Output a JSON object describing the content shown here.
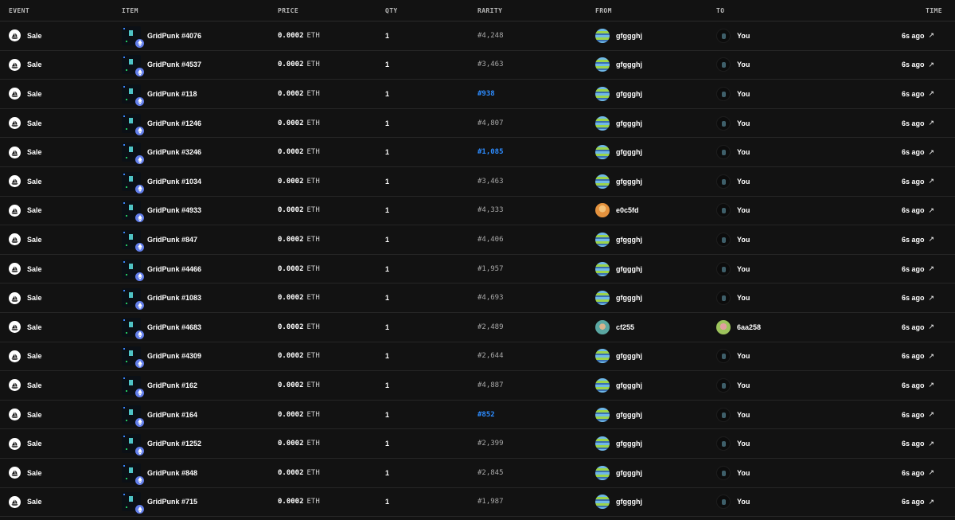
{
  "headers": {
    "event": "EVENT",
    "item": "ITEM",
    "price": "PRICE",
    "qty": "QTY",
    "rarity": "RARITY",
    "from": "FROM",
    "to": "TO",
    "time": "TIME"
  },
  "icons": {
    "event": "opensea-logo-icon",
    "chain": "ethereum-icon",
    "time": "external-link-arrow-icon"
  },
  "colors": {
    "background": "#121212",
    "highlight_rarity": "#2d8cff",
    "eth_badge": "#627eea"
  },
  "rows": [
    {
      "event": "Sale",
      "item": "GridPunk #4076",
      "price": "0.0002",
      "unit": "ETH",
      "qty": "1",
      "rarity": "#4,248",
      "rarity_highlight": false,
      "from": "gfggghj",
      "from_avatar": "stripe",
      "to": "You",
      "to_avatar": "dark",
      "time": "6s ago",
      "arrow": "↗"
    },
    {
      "event": "Sale",
      "item": "GridPunk #4537",
      "price": "0.0002",
      "unit": "ETH",
      "qty": "1",
      "rarity": "#3,463",
      "rarity_highlight": false,
      "from": "gfggghj",
      "from_avatar": "stripe",
      "to": "You",
      "to_avatar": "dark",
      "time": "6s ago",
      "arrow": "↗"
    },
    {
      "event": "Sale",
      "item": "GridPunk #118",
      "price": "0.0002",
      "unit": "ETH",
      "qty": "1",
      "rarity": "#938",
      "rarity_highlight": true,
      "from": "gfggghj",
      "from_avatar": "stripe",
      "to": "You",
      "to_avatar": "dark",
      "time": "6s ago",
      "arrow": "↗"
    },
    {
      "event": "Sale",
      "item": "GridPunk #1246",
      "price": "0.0002",
      "unit": "ETH",
      "qty": "1",
      "rarity": "#4,807",
      "rarity_highlight": false,
      "from": "gfggghj",
      "from_avatar": "stripe",
      "to": "You",
      "to_avatar": "dark",
      "time": "6s ago",
      "arrow": "↗"
    },
    {
      "event": "Sale",
      "item": "GridPunk #3246",
      "price": "0.0002",
      "unit": "ETH",
      "qty": "1",
      "rarity": "#1,085",
      "rarity_highlight": true,
      "from": "gfggghj",
      "from_avatar": "stripe",
      "to": "You",
      "to_avatar": "dark",
      "time": "6s ago",
      "arrow": "↗"
    },
    {
      "event": "Sale",
      "item": "GridPunk #1034",
      "price": "0.0002",
      "unit": "ETH",
      "qty": "1",
      "rarity": "#3,463",
      "rarity_highlight": false,
      "from": "gfggghj",
      "from_avatar": "stripe",
      "to": "You",
      "to_avatar": "dark",
      "time": "6s ago",
      "arrow": "↗"
    },
    {
      "event": "Sale",
      "item": "GridPunk #4933",
      "price": "0.0002",
      "unit": "ETH",
      "qty": "1",
      "rarity": "#4,333",
      "rarity_highlight": false,
      "from": "e0c5fd",
      "from_avatar": "orange",
      "to": "You",
      "to_avatar": "dark",
      "time": "6s ago",
      "arrow": "↗"
    },
    {
      "event": "Sale",
      "item": "GridPunk #847",
      "price": "0.0002",
      "unit": "ETH",
      "qty": "1",
      "rarity": "#4,406",
      "rarity_highlight": false,
      "from": "gfggghj",
      "from_avatar": "stripe",
      "to": "You",
      "to_avatar": "dark",
      "time": "6s ago",
      "arrow": "↗"
    },
    {
      "event": "Sale",
      "item": "GridPunk #4466",
      "price": "0.0002",
      "unit": "ETH",
      "qty": "1",
      "rarity": "#1,957",
      "rarity_highlight": false,
      "from": "gfggghj",
      "from_avatar": "stripe",
      "to": "You",
      "to_avatar": "dark",
      "time": "6s ago",
      "arrow": "↗"
    },
    {
      "event": "Sale",
      "item": "GridPunk #1083",
      "price": "0.0002",
      "unit": "ETH",
      "qty": "1",
      "rarity": "#4,693",
      "rarity_highlight": false,
      "from": "gfggghj",
      "from_avatar": "stripe",
      "to": "You",
      "to_avatar": "dark",
      "time": "6s ago",
      "arrow": "↗"
    },
    {
      "event": "Sale",
      "item": "GridPunk #4683",
      "price": "0.0002",
      "unit": "ETH",
      "qty": "1",
      "rarity": "#2,489",
      "rarity_highlight": false,
      "from": "cf255",
      "from_avatar": "teal",
      "to": "6aa258",
      "to_avatar": "green",
      "time": "6s ago",
      "arrow": "↗"
    },
    {
      "event": "Sale",
      "item": "GridPunk #4309",
      "price": "0.0002",
      "unit": "ETH",
      "qty": "1",
      "rarity": "#2,644",
      "rarity_highlight": false,
      "from": "gfggghj",
      "from_avatar": "stripe",
      "to": "You",
      "to_avatar": "dark",
      "time": "6s ago",
      "arrow": "↗"
    },
    {
      "event": "Sale",
      "item": "GridPunk #162",
      "price": "0.0002",
      "unit": "ETH",
      "qty": "1",
      "rarity": "#4,887",
      "rarity_highlight": false,
      "from": "gfggghj",
      "from_avatar": "stripe",
      "to": "You",
      "to_avatar": "dark",
      "time": "6s ago",
      "arrow": "↗"
    },
    {
      "event": "Sale",
      "item": "GridPunk #164",
      "price": "0.0002",
      "unit": "ETH",
      "qty": "1",
      "rarity": "#852",
      "rarity_highlight": true,
      "from": "gfggghj",
      "from_avatar": "stripe",
      "to": "You",
      "to_avatar": "dark",
      "time": "6s ago",
      "arrow": "↗"
    },
    {
      "event": "Sale",
      "item": "GridPunk #1252",
      "price": "0.0002",
      "unit": "ETH",
      "qty": "1",
      "rarity": "#2,399",
      "rarity_highlight": false,
      "from": "gfggghj",
      "from_avatar": "stripe",
      "to": "You",
      "to_avatar": "dark",
      "time": "6s ago",
      "arrow": "↗"
    },
    {
      "event": "Sale",
      "item": "GridPunk #848",
      "price": "0.0002",
      "unit": "ETH",
      "qty": "1",
      "rarity": "#2,845",
      "rarity_highlight": false,
      "from": "gfggghj",
      "from_avatar": "stripe",
      "to": "You",
      "to_avatar": "dark",
      "time": "6s ago",
      "arrow": "↗"
    },
    {
      "event": "Sale",
      "item": "GridPunk #715",
      "price": "0.0002",
      "unit": "ETH",
      "qty": "1",
      "rarity": "#1,987",
      "rarity_highlight": false,
      "from": "gfggghj",
      "from_avatar": "stripe",
      "to": "You",
      "to_avatar": "dark",
      "time": "6s ago",
      "arrow": "↗"
    }
  ]
}
